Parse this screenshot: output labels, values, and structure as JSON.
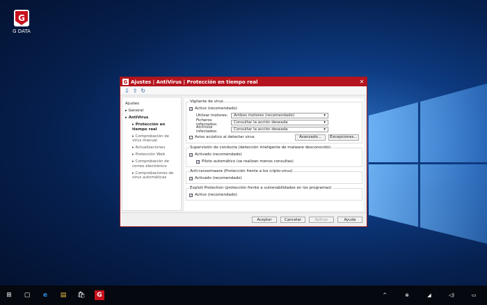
{
  "desktop": {
    "icon_label": "G DATA"
  },
  "dialog": {
    "title": "Ajustes | AntiVirus | Protección en tiempo real",
    "close": "✕",
    "toolbar": [
      "⇩",
      "⇧",
      "↻"
    ],
    "nav": {
      "header": "Ajustes",
      "items": [
        {
          "label": "General",
          "level": 0
        },
        {
          "label": "AntiVirus",
          "level": 0
        },
        {
          "label": "Protección en tiempo real",
          "level": 1,
          "selected": true
        },
        {
          "label": "Comprobación de virus manual",
          "level": 1
        },
        {
          "label": "Actualizaciones",
          "level": 1
        },
        {
          "label": "Protección Web",
          "level": 1
        },
        {
          "label": "Comprobación de correo electrónico",
          "level": 1
        },
        {
          "label": "Comprobaciones de virus automáticas",
          "level": 1
        }
      ]
    },
    "virus_guard": {
      "legend": "Vigilante de virus",
      "active": "Activo (recomendado)",
      "engines_label": "Utilizar motores:",
      "engines_value": "Ambos motores (recomendado)",
      "files_label": "Ficheros infectados:",
      "files_value": "Consultar la acción deseada",
      "archives_label": "Archivos infectados:",
      "archives_value": "Consultar la acción deseada",
      "sound": "Aviso acústico al detectar virus",
      "advanced": "Avanzado...",
      "exceptions": "Excepciones..."
    },
    "behavior": {
      "legend": "Supervisión de conducta (detección inteligente de malware desconocido)",
      "enabled": "Activado (recomendado)",
      "autopilot": "Piloto automático (se realizan menos consultas)"
    },
    "ransomware": {
      "legend": "Anti-ransomware (Protección frente a los cripto-virus)",
      "enabled": "Activado (recomendado)"
    },
    "exploit": {
      "legend": "Exploit Protection (protección frente a vulnerabilidades en los programas)",
      "enabled": "Activo (recomendado)"
    },
    "buttons": {
      "ok": "Aceptar",
      "cancel": "Cancelar",
      "apply": "Aplicar",
      "help": "Ayuda"
    }
  },
  "taskbar": {
    "icons": [
      "⊞",
      "▢",
      "e",
      "▤",
      "🛍",
      "G"
    ],
    "tray": [
      "^",
      "⊗",
      "◢",
      "◁)",
      "▭"
    ]
  }
}
